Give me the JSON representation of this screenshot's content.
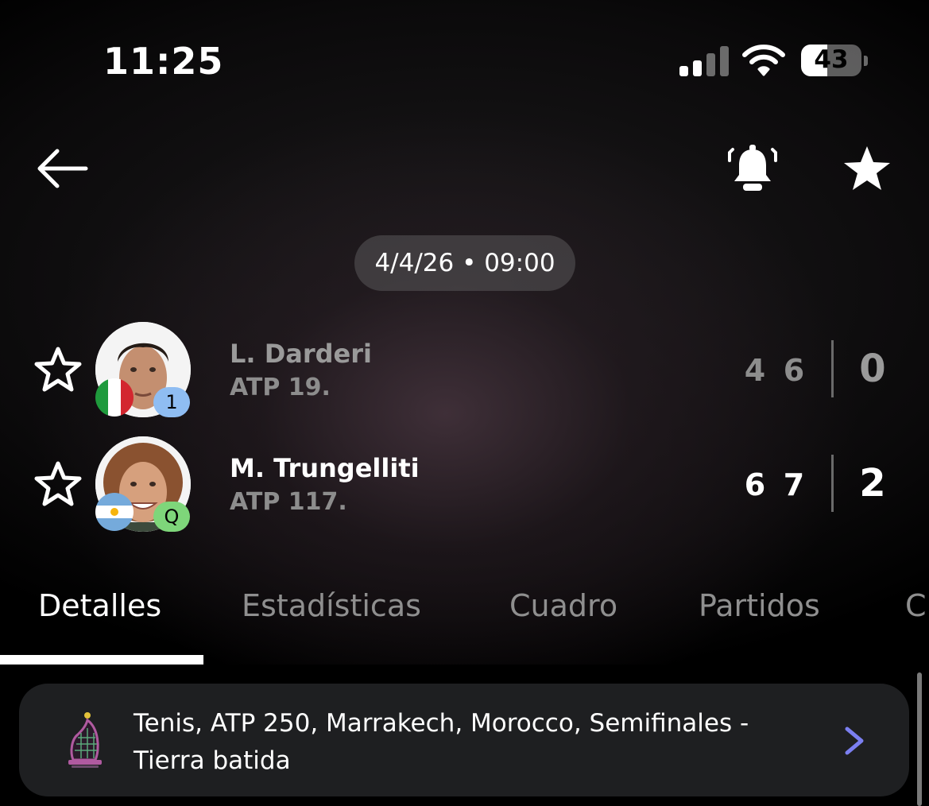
{
  "status_bar": {
    "time": "11:25",
    "battery": "43",
    "battery_level": 0.43,
    "signal_bars_active": 2,
    "signal_bars_total": 4,
    "icons": [
      "signal-icon",
      "wifi-icon",
      "battery-icon"
    ]
  },
  "nav": {
    "icons": [
      "back-arrow-icon",
      "bell-icon",
      "star-icon"
    ]
  },
  "match": {
    "datetime": "4/4/26 • 09:00",
    "players": [
      {
        "name": "L. Darderi",
        "rank": "ATP 19.",
        "badge": "1",
        "flag": "italy-flag-icon",
        "sets": [
          "4",
          "6"
        ],
        "total": "0",
        "winner": false,
        "badge_color": "#8fbdf2"
      },
      {
        "name": "M. Trungelliti",
        "rank": "ATP 117.",
        "badge": "Q",
        "flag": "argentina-flag-icon",
        "sets": [
          "6",
          "7"
        ],
        "total": "2",
        "winner": true,
        "badge_color": "#7ed67a"
      }
    ]
  },
  "tabs": [
    "Detalles",
    "Estadísticas",
    "Cuadro",
    "Partidos",
    "C"
  ],
  "active_tab": "Detalles",
  "tournament": {
    "line1": "Tenis, ATP 250, Marrakech, Morocco, Semifinales -",
    "line2": "Tierra batida",
    "logo": "atp-marrakech-logo-icon",
    "chevron": "chevron-right-icon",
    "chevron_color": "#7b7ff0"
  },
  "colors": {
    "background": "#000000",
    "card": "#1e1f21",
    "accent": "#7b7ff0",
    "dim_text": "#9a9a9a"
  }
}
